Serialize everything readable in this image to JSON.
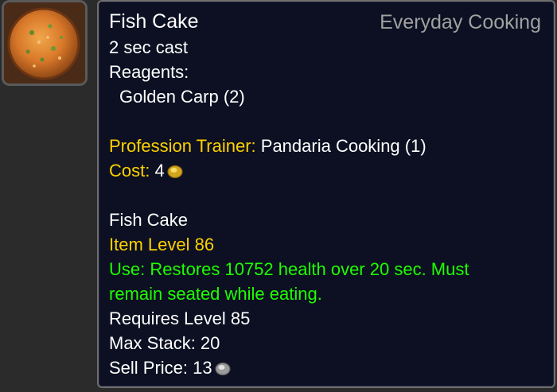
{
  "spell": {
    "name": "Fish Cake",
    "category": "Everyday Cooking",
    "cast_time": "2 sec cast",
    "reagents_label": "Reagents:",
    "reagent": "Golden Carp (2)",
    "trainer_label": "Profession Trainer:",
    "trainer_value": "Pandaria Cooking (1)",
    "cost_label": "Cost:",
    "cost_value": "4",
    "cost_icon": "gold-coin-icon"
  },
  "item": {
    "name": "Fish Cake",
    "item_level": "Item Level 86",
    "use_line1": "Use: Restores 10752 health over 20 sec.  Must",
    "use_line2": "remain seated while eating.",
    "requires": "Requires Level 85",
    "max_stack": "Max Stack: 20",
    "sell_price_label": "Sell Price:",
    "sell_price_value": "13",
    "sell_price_icon": "silver-coin-icon"
  },
  "icon": "fish-cake-icon",
  "colors": {
    "background": "#0c1022",
    "gold_text": "#ffd100",
    "green_text": "#1eff00",
    "category_text": "#a0a0a0"
  }
}
